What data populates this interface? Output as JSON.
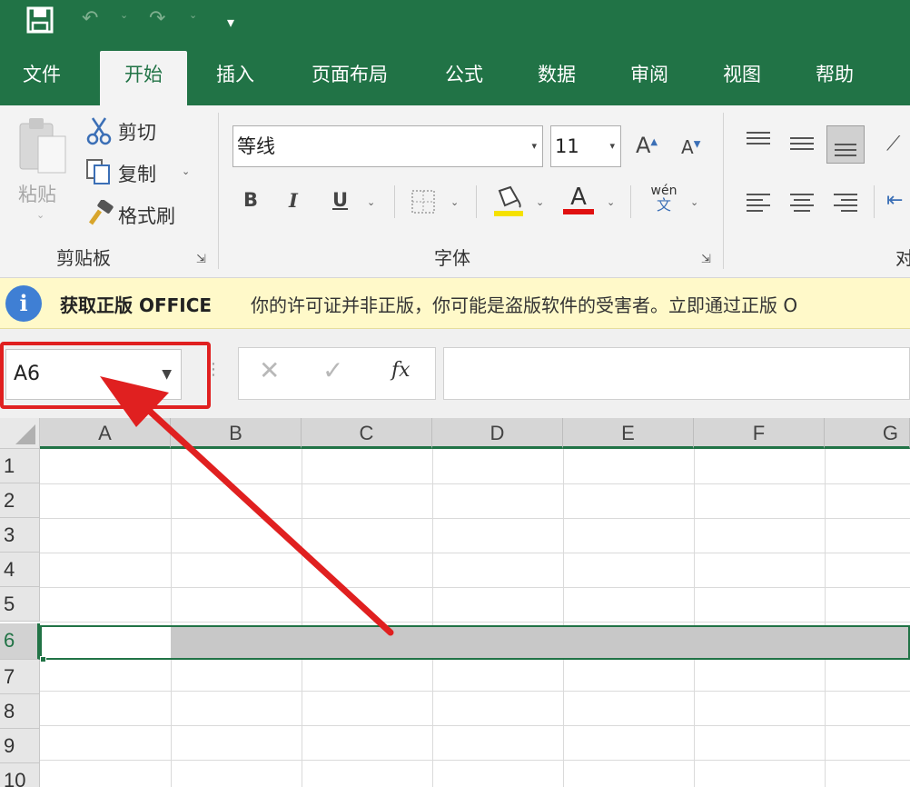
{
  "quick_access": {
    "save_icon": "save-icon",
    "undo_icon": "undo-icon",
    "redo_icon": "redo-icon",
    "customize_icon": "customize-qat-icon"
  },
  "tabs": [
    {
      "label": "文件"
    },
    {
      "label": "开始"
    },
    {
      "label": "插入"
    },
    {
      "label": "页面布局"
    },
    {
      "label": "公式"
    },
    {
      "label": "数据"
    },
    {
      "label": "审阅"
    },
    {
      "label": "视图"
    },
    {
      "label": "帮助"
    }
  ],
  "ribbon": {
    "clipboard": {
      "paste_label": "粘贴",
      "cut_label": "剪切",
      "copy_label": "复制",
      "format_painter_label": "格式刷",
      "group_label": "剪贴板"
    },
    "font": {
      "font_name": "等线",
      "font_size": "11",
      "bold": "B",
      "italic": "I",
      "underline": "U",
      "grow": "A",
      "shrink": "A",
      "font_color_letter": "A",
      "phonetic_top": "wén",
      "phonetic_bottom": "文",
      "group_label": "字体"
    },
    "alignment": {
      "group_label_partial": "对"
    }
  },
  "infobar": {
    "title": "获取正版 OFFICE",
    "message": "你的许可证并非正版，你可能是盗版软件的受害者。立即通过正版 O"
  },
  "formula_bar": {
    "name_box": "A6",
    "fx": "fx",
    "formula": ""
  },
  "grid": {
    "columns": [
      "A",
      "B",
      "C",
      "D",
      "E",
      "F",
      "G"
    ],
    "rows": [
      "1",
      "2",
      "3",
      "4",
      "5",
      "6",
      "7",
      "8",
      "9",
      "10"
    ],
    "selected_row": "6",
    "active_cell": "A6"
  },
  "colors": {
    "excel_green": "#217346",
    "annotation_red": "#e02020"
  }
}
